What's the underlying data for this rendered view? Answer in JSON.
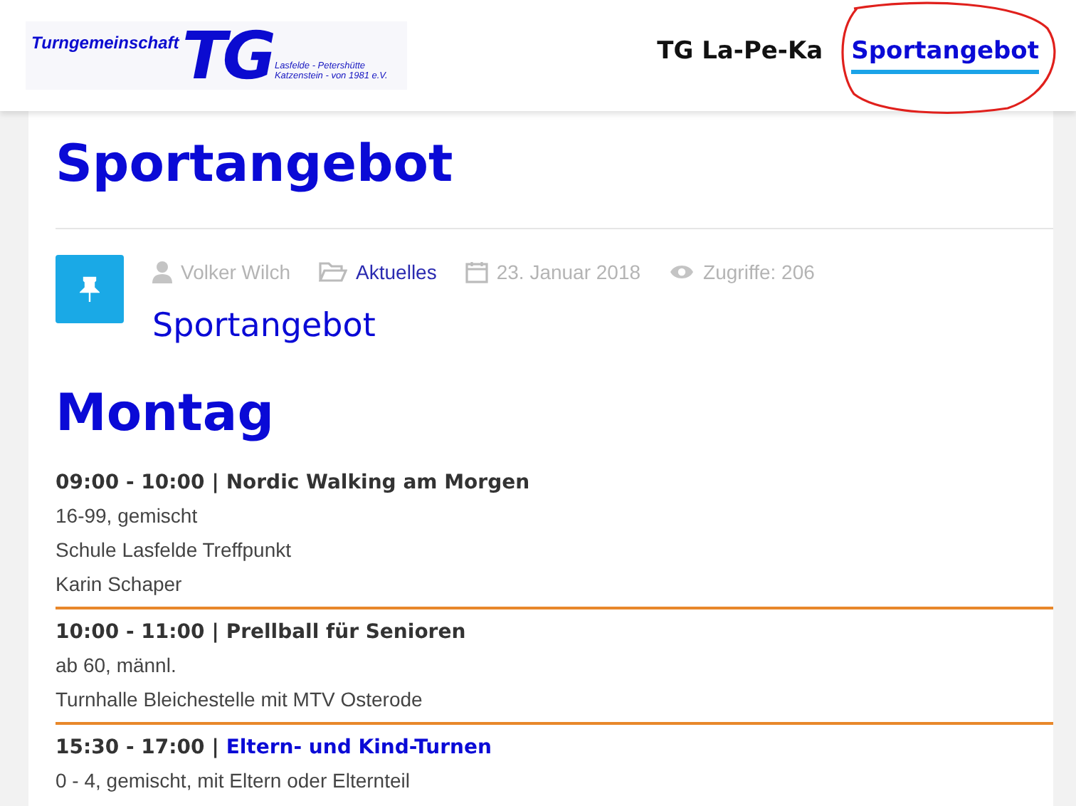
{
  "logo": {
    "name": "Turngemeinschaft",
    "initials": "TG",
    "lines": [
      "Lasfelde - Petershütte",
      "Katzenstein - von 1981 e.V."
    ]
  },
  "nav": [
    {
      "label": "TG La-Pe-Ka",
      "selected": false
    },
    {
      "label": "Sportangebot",
      "selected": true
    }
  ],
  "annotation": {
    "kind": "circle"
  },
  "article": {
    "title": "Sportangebot",
    "meta": {
      "author": "Volker Wilch",
      "category": "Aktuelles",
      "date": "23. Januar 2018",
      "hits": "Zugriffe: 206"
    },
    "subtitle": "Sportangebot",
    "day": "Montag",
    "entries": [
      {
        "time": "09:00 - 10:00",
        "separator": "|",
        "name": "Nordic Walking am Morgen",
        "link": false,
        "details": [
          "16-99, gemischt",
          "Schule Lasfelde Treffpunkt",
          "Karin Schaper"
        ]
      },
      {
        "time": "10:00 - 11:00",
        "separator": "|",
        "name": "Prellball für Senioren",
        "link": false,
        "details": [
          "ab 60, männl.",
          "Turnhalle Bleichestelle mit MTV Osterode"
        ]
      },
      {
        "time": "15:30 - 17:00",
        "separator": "|",
        "name": "Eltern- und Kind-Turnen",
        "link": true,
        "details": [
          "0 - 4, gemischt, mit Eltern oder Elternteil"
        ]
      }
    ]
  }
}
